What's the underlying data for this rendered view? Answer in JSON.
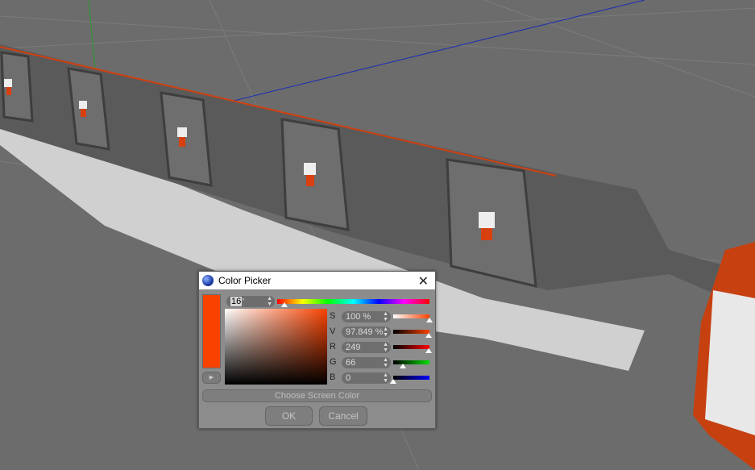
{
  "dialog": {
    "title": "Color Picker",
    "hue_value": "16",
    "hue_unit": "°",
    "current_color": "#f94200",
    "fields": [
      {
        "label": "S",
        "value": "100 %",
        "fraction": 1.0
      },
      {
        "label": "V",
        "value": "97.849 %",
        "fraction": 0.978
      },
      {
        "label": "R",
        "value": "249",
        "fraction": 0.976
      },
      {
        "label": "G",
        "value": "66",
        "fraction": 0.259
      },
      {
        "label": "B",
        "value": "0",
        "fraction": 0.0
      }
    ],
    "choose_screen_color": "Choose Screen Color",
    "ok": "OK",
    "cancel": "Cancel",
    "close_icon": "close-icon",
    "app_icon": "cinema4d-logo-icon"
  }
}
